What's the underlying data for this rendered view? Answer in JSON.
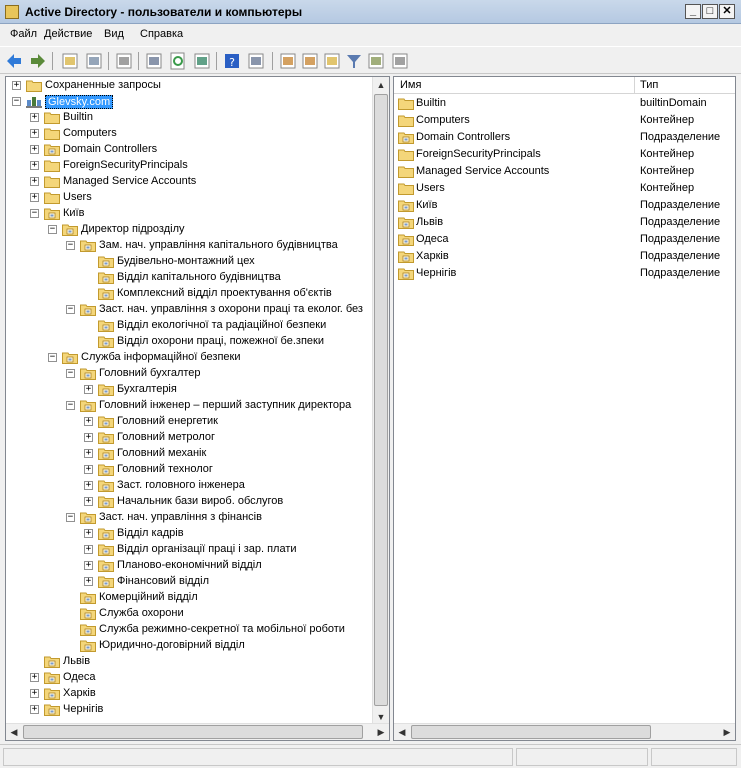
{
  "window": {
    "title": "Active Directory - пользователи и компьютеры",
    "minimize": "_",
    "maximize": "□",
    "close": "✕"
  },
  "menu": [
    "Файл",
    "Действие",
    "Вид",
    "Справка"
  ],
  "toolbar": {
    "icons": [
      "back-arrow-icon",
      "forward-arrow-icon",
      "up-folder-icon",
      "console-tree-icon",
      "clipboard-icon",
      "properties-icon",
      "refresh-icon",
      "export-list-icon",
      "help-icon",
      "show-pane-icon",
      "new-user-icon",
      "new-group-icon",
      "new-ou-icon",
      "filter-icon",
      "find-icon",
      "delegate-icon"
    ]
  },
  "tree": [
    {
      "label": "Сохраненные запросы",
      "level": 0,
      "exp": "+",
      "icon": "folder"
    },
    {
      "label": "Glevsky.com",
      "level": 0,
      "exp": "-",
      "icon": "domain",
      "selected": true
    },
    {
      "label": "Builtin",
      "level": 1,
      "exp": "+",
      "icon": "folder"
    },
    {
      "label": "Computers",
      "level": 1,
      "exp": "+",
      "icon": "folder"
    },
    {
      "label": "Domain Controllers",
      "level": 1,
      "exp": "+",
      "icon": "ou"
    },
    {
      "label": "ForeignSecurityPrincipals",
      "level": 1,
      "exp": "+",
      "icon": "folder"
    },
    {
      "label": "Managed Service Accounts",
      "level": 1,
      "exp": "+",
      "icon": "folder"
    },
    {
      "label": "Users",
      "level": 1,
      "exp": "+",
      "icon": "folder"
    },
    {
      "label": "Київ",
      "level": 1,
      "exp": "-",
      "icon": "ou"
    },
    {
      "label": "Директор підрозділу",
      "level": 2,
      "exp": "-",
      "icon": "ou"
    },
    {
      "label": "Зам. нач. управління капітального будівництва",
      "level": 3,
      "exp": "-",
      "icon": "ou"
    },
    {
      "label": "Будівельно-монтажний цех",
      "level": 4,
      "exp": "",
      "icon": "ou"
    },
    {
      "label": "Відділ капітального будівництва",
      "level": 4,
      "exp": "",
      "icon": "ou"
    },
    {
      "label": "Комплексний відділ проектування  об'єктів",
      "level": 4,
      "exp": "",
      "icon": "ou"
    },
    {
      "label": "Заст. нач. управління з охорони праці та еколог. без",
      "level": 3,
      "exp": "-",
      "icon": "ou"
    },
    {
      "label": "Відділ екологічної та радіаційної безпеки",
      "level": 4,
      "exp": "",
      "icon": "ou"
    },
    {
      "label": "Відділ охорони праці, пожежної бе.зпеки",
      "level": 4,
      "exp": "",
      "icon": "ou"
    },
    {
      "label": "Служба інформаційної безпеки",
      "level": 2,
      "exp": "-",
      "icon": "ou"
    },
    {
      "label": "Головний бухгалтер",
      "level": 3,
      "exp": "-",
      "icon": "ou"
    },
    {
      "label": "Бухгалтерія",
      "level": 4,
      "exp": "+",
      "icon": "ou"
    },
    {
      "label": "Головний інженер – перший заступник директора",
      "level": 3,
      "exp": "-",
      "icon": "ou"
    },
    {
      "label": "Головний енергетик",
      "level": 4,
      "exp": "+",
      "icon": "ou"
    },
    {
      "label": "Головний метролог",
      "level": 4,
      "exp": "+",
      "icon": "ou"
    },
    {
      "label": "Головний механік",
      "level": 4,
      "exp": "+",
      "icon": "ou"
    },
    {
      "label": "Головний технолог",
      "level": 4,
      "exp": "+",
      "icon": "ou"
    },
    {
      "label": "Заст. головного інженера",
      "level": 4,
      "exp": "+",
      "icon": "ou"
    },
    {
      "label": "Начальник бази вироб. обслугов",
      "level": 4,
      "exp": "+",
      "icon": "ou"
    },
    {
      "label": "Заст. нач. управління з фінансів",
      "level": 3,
      "exp": "-",
      "icon": "ou"
    },
    {
      "label": "Відділ кадрів",
      "level": 4,
      "exp": "+",
      "icon": "ou"
    },
    {
      "label": "Відділ організації праці і зар. плати",
      "level": 4,
      "exp": "+",
      "icon": "ou"
    },
    {
      "label": "Планово-економічний відділ",
      "level": 4,
      "exp": "+",
      "icon": "ou"
    },
    {
      "label": "Фінансовий відділ",
      "level": 4,
      "exp": "+",
      "icon": "ou"
    },
    {
      "label": "Комерційний відділ",
      "level": 3,
      "exp": "",
      "icon": "ou"
    },
    {
      "label": "Служба охорони",
      "level": 3,
      "exp": "",
      "icon": "ou"
    },
    {
      "label": "Служба режимно-секретної та мобільної роботи",
      "level": 3,
      "exp": "",
      "icon": "ou"
    },
    {
      "label": "Юридично-договірний відділ",
      "level": 3,
      "exp": "",
      "icon": "ou"
    },
    {
      "label": "Львів",
      "level": 1,
      "exp": "",
      "icon": "ou"
    },
    {
      "label": "Одеса",
      "level": 1,
      "exp": "+",
      "icon": "ou"
    },
    {
      "label": "Харків",
      "level": 1,
      "exp": "+",
      "icon": "ou"
    },
    {
      "label": "Чернігів",
      "level": 1,
      "exp": "+",
      "icon": "ou"
    }
  ],
  "list": {
    "columns": [
      "Имя",
      "Тип"
    ],
    "rows": [
      {
        "name": "Builtin",
        "type": "builtinDomain",
        "icon": "folder"
      },
      {
        "name": "Computers",
        "type": "Контейнер",
        "icon": "folder"
      },
      {
        "name": "Domain Controllers",
        "type": "Подразделение",
        "icon": "ou"
      },
      {
        "name": "ForeignSecurityPrincipals",
        "type": "Контейнер",
        "icon": "folder"
      },
      {
        "name": "Managed Service Accounts",
        "type": "Контейнер",
        "icon": "folder"
      },
      {
        "name": "Users",
        "type": "Контейнер",
        "icon": "folder"
      },
      {
        "name": "Київ",
        "type": "Подразделение",
        "icon": "ou"
      },
      {
        "name": "Львів",
        "type": "Подразделение",
        "icon": "ou"
      },
      {
        "name": "Одеса",
        "type": "Подразделение",
        "icon": "ou"
      },
      {
        "name": "Харків",
        "type": "Подразделение",
        "icon": "ou"
      },
      {
        "name": "Чернігів",
        "type": "Подразделение",
        "icon": "ou"
      }
    ]
  },
  "colors": {
    "folder": "#f4d67a",
    "folder_edge": "#c29a2e",
    "selection": "#3399ff"
  }
}
